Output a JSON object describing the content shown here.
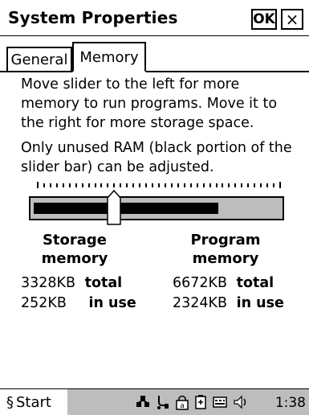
{
  "window": {
    "title": "System Properties",
    "ok_label": "OK",
    "close_label": "×"
  },
  "tabs": [
    {
      "label": "General",
      "active": false
    },
    {
      "label": "Memory",
      "active": true
    }
  ],
  "memory": {
    "instructions": "Move slider to the left for more memory to run programs. Move it to the right for more storage space.",
    "note": "Only unused RAM (black portion of the slider bar) can be adjusted.",
    "slider_storage_fraction": 0.333,
    "storage": {
      "heading_line1": "Storage",
      "heading_line2": "memory",
      "total_value": "3328KB",
      "total_label": "total",
      "in_use_value": "252KB",
      "in_use_label": "in use"
    },
    "program": {
      "heading_line1": "Program",
      "heading_line2": "memory",
      "total_value": "6672KB",
      "total_label": "total",
      "in_use_value": "2324KB",
      "in_use_label": "in use"
    }
  },
  "taskbar": {
    "start_label": "Start",
    "clock": "1:38",
    "tray_icons": [
      "network-icon",
      "usb-connection-icon",
      "keyboard-lock-icon",
      "battery-icon",
      "input-panel-icon",
      "volume-icon"
    ]
  },
  "colors": {
    "taskbar_bg": "#bdbdbd",
    "slider_track_bg": "#bdbdbd",
    "slider_fill": "#000000"
  }
}
